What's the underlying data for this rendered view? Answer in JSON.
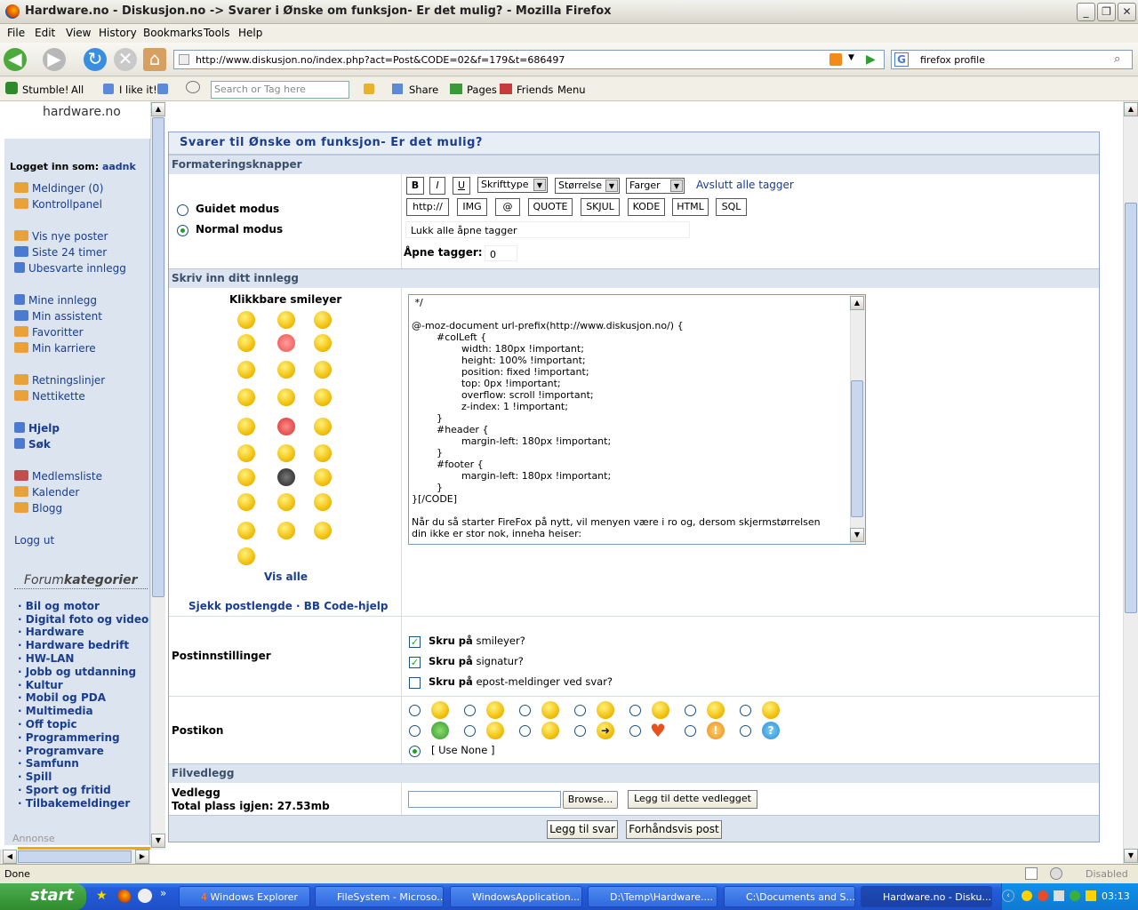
{
  "window": {
    "title": "Hardware.no - Diskusjon.no -> Svarer i Ønske om funksjon- Er det mulig? - Mozilla Firefox"
  },
  "menu": [
    "File",
    "Edit",
    "View",
    "History",
    "Bookmarks",
    "Tools",
    "Help"
  ],
  "nav": {
    "url": "http://www.diskusjon.no/index.php?act=Post&CODE=02&f=179&t=686497",
    "search_value": "firefox profile"
  },
  "stumble": {
    "stumble": "Stumble!",
    "all": "All",
    "like": "I like it!",
    "tag_placeholder": "Search or Tag here",
    "share": "Share",
    "pages": "Pages",
    "friends": "Friends",
    "menu": "Menu"
  },
  "sidebar": {
    "logo": "hardware.no",
    "logged_in_label": "Logget inn som:",
    "user": "aadnk",
    "items": [
      "Meldinger (0)",
      "Kontrollpanel",
      "Vis nye poster",
      "Siste 24 timer",
      "Ubesvarte innlegg",
      "Mine innlegg",
      "Min assistent",
      "Favoritter",
      "Min karriere",
      "Retningslinjer",
      "Nettikette"
    ],
    "help": "Hjelp",
    "search": "Søk",
    "items2": [
      "Medlemsliste",
      "Kalender",
      "Blogg"
    ],
    "logout": "Logg ut",
    "cat_title_a": "Forum",
    "cat_title_b": "kategorier",
    "categories": [
      "Bil og motor",
      "Digital foto og video",
      "Hardware",
      "Hardware bedrift",
      "HW-LAN",
      "Jobb og utdanning",
      "Kultur",
      "Mobil og PDA",
      "Multimedia",
      "Off topic",
      "Programmering",
      "Programvare",
      "Samfunn",
      "Spill",
      "Sport og fritid",
      "Tilbakemeldinger"
    ],
    "annonse": "Annonse"
  },
  "form": {
    "title": "Svarer til Ønske om funksjon- Er det mulig?",
    "format_header": "Formateringsknapper",
    "guided": "Guidet modus",
    "normal": "Normal modus",
    "bold": "B",
    "italic": "I",
    "underline": "U",
    "font": "Skrifttype",
    "size": "Størrelse",
    "color": "Farger",
    "close_all": "Avslutt alle tagger",
    "tag_buttons": [
      "http://",
      "IMG",
      "@",
      "QUOTE",
      "SKJUL",
      "KODE",
      "HTML",
      "SQL"
    ],
    "close_open": "Lukk alle åpne tagger",
    "open_tags_label": "Åpne tagger:",
    "open_tags_value": "0",
    "write_header": "Skriv inn ditt innlegg",
    "smileys_title": "Klikkbare smileyer",
    "show_all": "Vis alle",
    "check_length": "Sjekk postlengde",
    "bbcode_help": "BB Code-hjelp",
    "code_text": " */\n\n@-moz-document url-prefix(http://www.diskusjon.no/) {\n        #colLeft {\n                width: 180px !important;\n                height: 100% !important;\n                position: fixed !important;\n                top: 0px !important;\n                overflow: scroll !important;\n                z-index: 1 !important;\n        }\n        #header {\n                margin-left: 180px !important;\n        }\n        #footer {\n                margin-left: 180px !important;\n        }\n}[/CODE]\n\nNår du så starter FireFox på nytt, vil menyen være i ro og, dersom skjermstørrelsen\ndin ikke er stor nok, inneha heiser:",
    "post_settings": "Postinnstillinger",
    "opt1_b": "Skru på",
    "opt1": "smileyer?",
    "opt2_b": "Skru på",
    "opt2": "signatur?",
    "opt3_b": "Skru på",
    "opt3": "epost-meldinger ved svar?",
    "post_icon": "Postikon",
    "use_none": "[ Use None ]",
    "attach_header": "Filvedlegg",
    "attach_label": "Vedlegg",
    "space_left": "Total plass igjen: 27.53mb",
    "browse": "Browse...",
    "add_attach": "Legg til dette vedlegget",
    "submit": "Legg til svar",
    "preview": "Forhåndsvis post"
  },
  "status": {
    "text": "Done",
    "disabled": "Disabled"
  },
  "taskbar": {
    "start": "start",
    "tasks": [
      "Windows Explorer",
      "FileSystem - Microso...",
      "WindowsApplication...",
      "D:\\Temp\\Hardware....",
      "C:\\Documents and S...",
      "Hardware.no - Disku..."
    ],
    "explorer_count": "4",
    "clock": "03:13"
  }
}
